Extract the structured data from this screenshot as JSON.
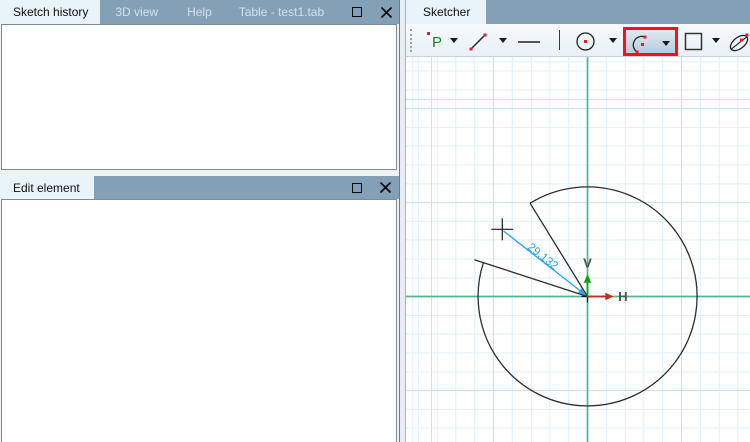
{
  "sketch_history_panel": {
    "tabs": [
      "Sketch history",
      "3D view",
      "Help",
      "Table - test1.tab"
    ],
    "active_tab": "Sketch history",
    "window_buttons": [
      "maximize-icon",
      "close-icon"
    ]
  },
  "edit_element_panel": {
    "title": "Edit element",
    "window_buttons": [
      "maximize-icon",
      "close-icon"
    ]
  },
  "sketcher_panel": {
    "title": "Sketcher",
    "toolbar": {
      "tools": [
        {
          "name": "point",
          "icon": "point-icon",
          "letter": "P",
          "has_dropdown": true
        },
        {
          "name": "line",
          "icon": "line-icon",
          "has_dropdown": true
        },
        {
          "name": "horizontal-line",
          "icon": "horizontal-line-icon",
          "has_dropdown": false
        },
        {
          "name": "circle",
          "icon": "circle-icon",
          "has_dropdown": true
        },
        {
          "name": "arc",
          "icon": "arc-icon",
          "has_dropdown": true,
          "highlighted": true
        },
        {
          "name": "rectangle",
          "icon": "rectangle-icon",
          "has_dropdown": true
        },
        {
          "name": "ellipse",
          "icon": "ellipse-icon",
          "has_dropdown": false
        }
      ],
      "highlighted_tool": "arc",
      "highlight_color": "#fb0d1b"
    },
    "canvas": {
      "dimension_label": "29.132",
      "axis_v_label": "V",
      "axis_h_label": "H",
      "colors": {
        "axis_green": "#4cba8b",
        "grid_minor": "#def0fa",
        "grid_major": "#c4e5f5",
        "geometry_black": "#2d2d2d",
        "dimension_cyan": "#25a9e8",
        "v_arrow_green": "#12a312",
        "h_arrow_red": "#bf2d1e",
        "axis_label_gray": "#4f4f4f",
        "icon_dot_red": "#ea1c24",
        "icon_point_green": "#1e7d1e"
      }
    }
  }
}
